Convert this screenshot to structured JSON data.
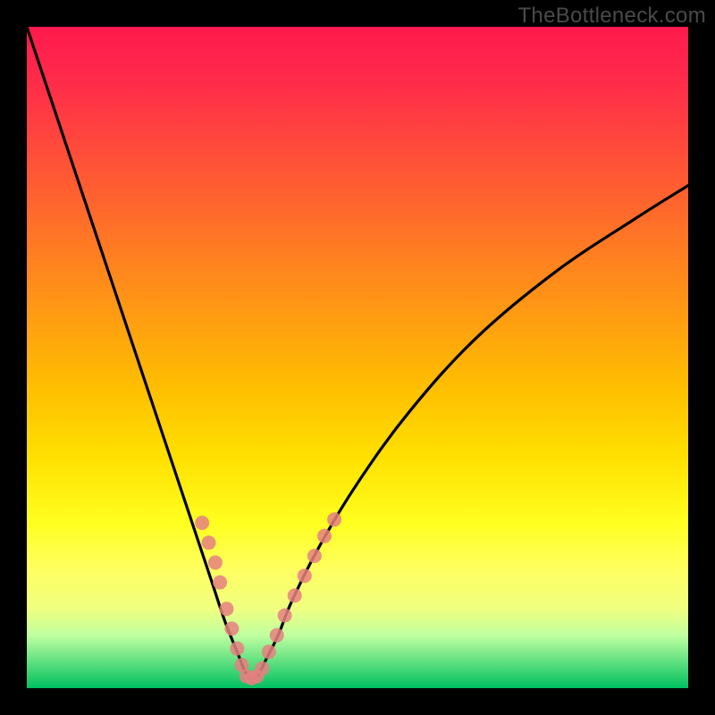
{
  "watermark": "TheBottleneck.com",
  "chart_data": {
    "type": "line",
    "title": "",
    "xlabel": "",
    "ylabel": "",
    "xlim": [
      0,
      100
    ],
    "ylim": [
      0,
      100
    ],
    "curve": {
      "name": "bottleneck-curve",
      "x": [
        0,
        4,
        8,
        12,
        16,
        20,
        23,
        26,
        28,
        30,
        32,
        33,
        34,
        35,
        36,
        38,
        40,
        44,
        50,
        58,
        68,
        80,
        92,
        100
      ],
      "y": [
        100,
        88,
        76,
        64,
        52,
        40,
        31,
        22,
        16,
        10,
        5,
        2.5,
        1.5,
        2,
        4,
        8,
        13,
        21,
        31,
        42,
        53,
        63,
        71,
        76
      ]
    },
    "markers": {
      "name": "highlight-dots",
      "color": "#e58080",
      "radius": 8,
      "points": [
        {
          "x": 26.5,
          "y": 25
        },
        {
          "x": 27.5,
          "y": 22
        },
        {
          "x": 28.5,
          "y": 19
        },
        {
          "x": 29.2,
          "y": 16
        },
        {
          "x": 30.2,
          "y": 12
        },
        {
          "x": 31.0,
          "y": 9
        },
        {
          "x": 31.8,
          "y": 6
        },
        {
          "x": 32.5,
          "y": 3.5
        },
        {
          "x": 33.2,
          "y": 1.8
        },
        {
          "x": 34.0,
          "y": 1.5
        },
        {
          "x": 34.8,
          "y": 1.8
        },
        {
          "x": 35.6,
          "y": 3
        },
        {
          "x": 36.6,
          "y": 5.5
        },
        {
          "x": 37.8,
          "y": 8
        },
        {
          "x": 39.0,
          "y": 11
        },
        {
          "x": 40.5,
          "y": 14
        },
        {
          "x": 42.0,
          "y": 17
        },
        {
          "x": 43.5,
          "y": 20
        },
        {
          "x": 45.0,
          "y": 23
        },
        {
          "x": 46.5,
          "y": 25.5
        }
      ]
    }
  }
}
